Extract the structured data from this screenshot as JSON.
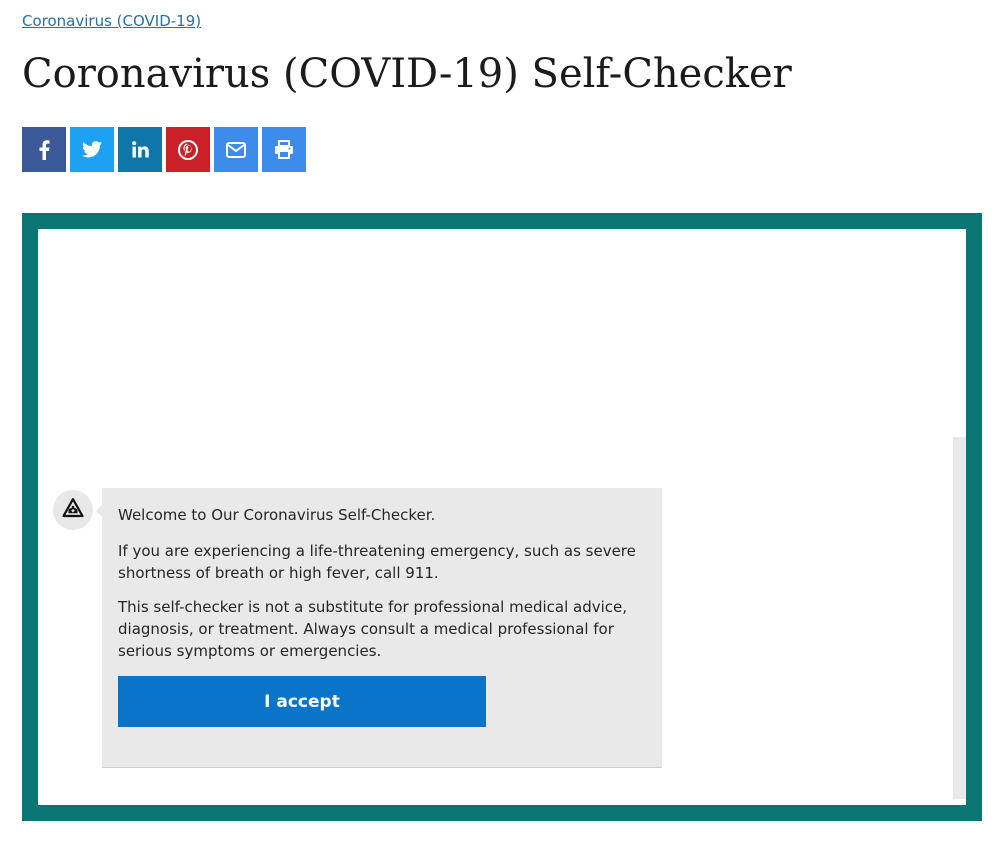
{
  "breadcrumb": {
    "label": "Coronavirus (COVID-19)"
  },
  "page": {
    "title": "Coronavirus (COVID-19) Self-Checker"
  },
  "share": {
    "buttons": [
      {
        "icon": "facebook-icon",
        "color": "#3b5998"
      },
      {
        "icon": "twitter-icon",
        "color": "#1da1f2"
      },
      {
        "icon": "linkedin-icon",
        "color": "#0e76a8"
      },
      {
        "icon": "pinterest-icon",
        "color": "#cb2027"
      },
      {
        "icon": "email-icon",
        "color": "#3d8bea"
      },
      {
        "icon": "print-icon",
        "color": "#3d8bea"
      }
    ]
  },
  "checker": {
    "frame_color": "#0a7572",
    "bot_icon": "medical-bot-icon",
    "messages": {
      "welcome": "Welcome to Our Coronavirus Self-Checker.",
      "emergency": "If you are experiencing a life-threatening emergency, such as severe shortness of breath or high fever, call 911.",
      "disclaimer": "This self-checker is not a substitute for professional medical advice, diagnosis, or treatment. Always consult a medical professional for serious symptoms or emergencies."
    },
    "accept_label": "I accept",
    "accept_color": "#0a74c9"
  }
}
